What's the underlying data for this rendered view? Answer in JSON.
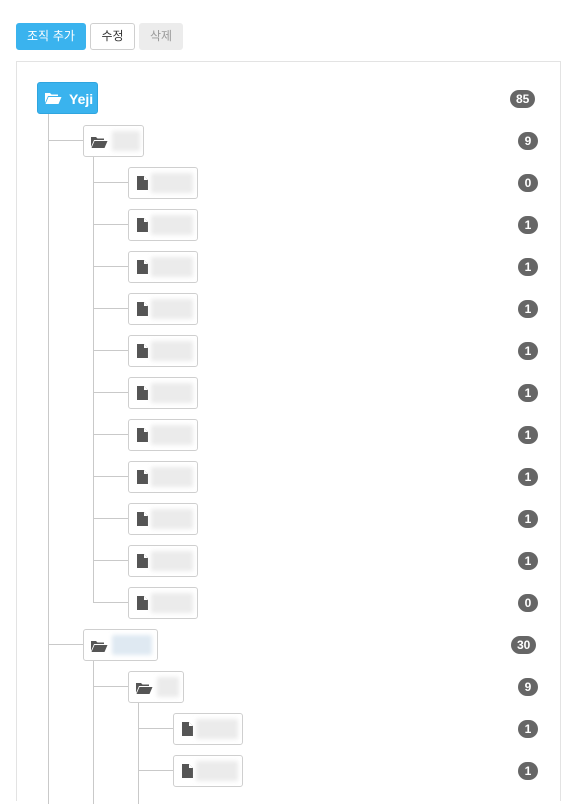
{
  "toolbar": {
    "add_label": "조직 추가",
    "edit_label": "수정",
    "delete_label": "삭제"
  },
  "tree": {
    "root": {
      "label": "Yeji",
      "count": "85"
    },
    "group1": {
      "count": "9",
      "children": [
        "0",
        "1",
        "1",
        "1",
        "1",
        "1",
        "1",
        "1",
        "1",
        "1",
        "0"
      ]
    },
    "group2": {
      "count": "30",
      "subgroup": {
        "count": "9",
        "children": [
          "1",
          "1"
        ]
      }
    }
  },
  "colors": {
    "primary": "#3ab3ee",
    "badge": "#666666",
    "connector": "#c9c9c9"
  },
  "icons": {
    "folder": "folder-open-icon",
    "file": "file-icon"
  }
}
